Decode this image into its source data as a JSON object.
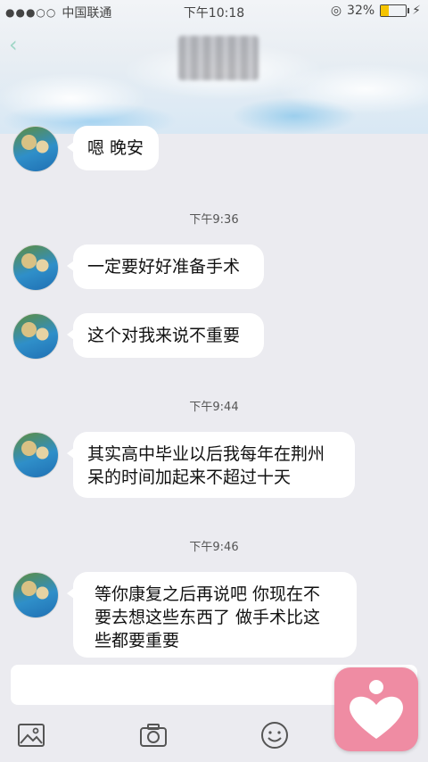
{
  "status_bar": {
    "signal_dots": "●●●○○",
    "carrier": "中国联通",
    "time": "下午10:18",
    "battery_percent": "32%",
    "battery_level": 0.32
  },
  "header": {
    "back_icon": "chevron-left-icon"
  },
  "messages": [
    {
      "text": "嗯 晚安"
    },
    {
      "text": "一定要好好准备手术"
    },
    {
      "text": "这个对我来说不重要"
    },
    {
      "text_lines": [
        "其实高中毕业以后我每年在荆州",
        "呆的时间加起来不超过十天"
      ]
    },
    {
      "text_lines": [
        "等你康复之后再说吧 你现在不",
        "要去想这些东西了 做手术比这",
        "些都要重要"
      ]
    }
  ],
  "timestamps": [
    "下午9:36",
    "下午9:44",
    "下午9:46"
  ],
  "toolbar": {
    "icons": [
      "image-icon",
      "camera-icon",
      "emoji-icon",
      "more-icon"
    ]
  },
  "colors": {
    "background": "#ebebf0",
    "bubble": "#ffffff",
    "fab": "#ef8ca3",
    "back_accent": "#9fd6c6"
  }
}
